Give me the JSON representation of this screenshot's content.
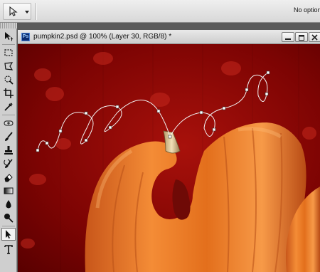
{
  "options_bar": {
    "tool_preset_icon": "pen-icon",
    "options_text": "No options"
  },
  "toolbox": {
    "tools": [
      "move-icon",
      "marquee-icon",
      "lasso-icon",
      "quick-selection-icon",
      "crop-icon",
      "eyedropper-icon",
      "spot-healing-icon",
      "brush-icon",
      "clone-stamp-icon",
      "history-brush-icon",
      "eraser-icon",
      "gradient-icon",
      "blur-icon",
      "dodge-icon",
      "pen-icon",
      "type-icon"
    ],
    "active_tool": "pen-icon"
  },
  "document": {
    "app_badge": "Ps",
    "title": "pumpkin2.psd @ 100% (Layer 30, RGB/8) *",
    "colors": {
      "background_dark": "#6b0000",
      "background_mid": "#9c0a06",
      "pumpkin_orange": "#e8741e",
      "pumpkin_highlight": "#fba255"
    }
  }
}
